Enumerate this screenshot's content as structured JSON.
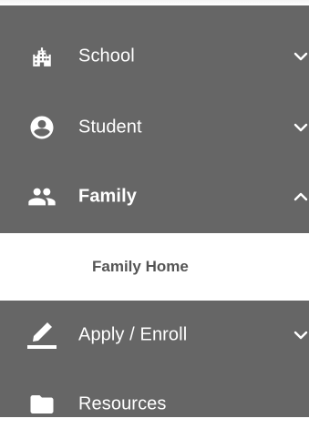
{
  "nav": {
    "items": [
      {
        "label": "School",
        "icon": "building-icon",
        "expanded": false
      },
      {
        "label": "Student",
        "icon": "account-circle-icon",
        "expanded": false
      },
      {
        "label": "Family",
        "icon": "people-icon",
        "expanded": true,
        "children": [
          {
            "label": "Family Home"
          }
        ]
      },
      {
        "label": "Apply / Enroll",
        "icon": "pencil-underline-icon",
        "expanded": false
      },
      {
        "label": "Resources",
        "icon": "folder-icon"
      }
    ]
  },
  "colors": {
    "panel": "#666666",
    "text_on_panel": "#ffffff",
    "subitem_text": "#555555"
  }
}
